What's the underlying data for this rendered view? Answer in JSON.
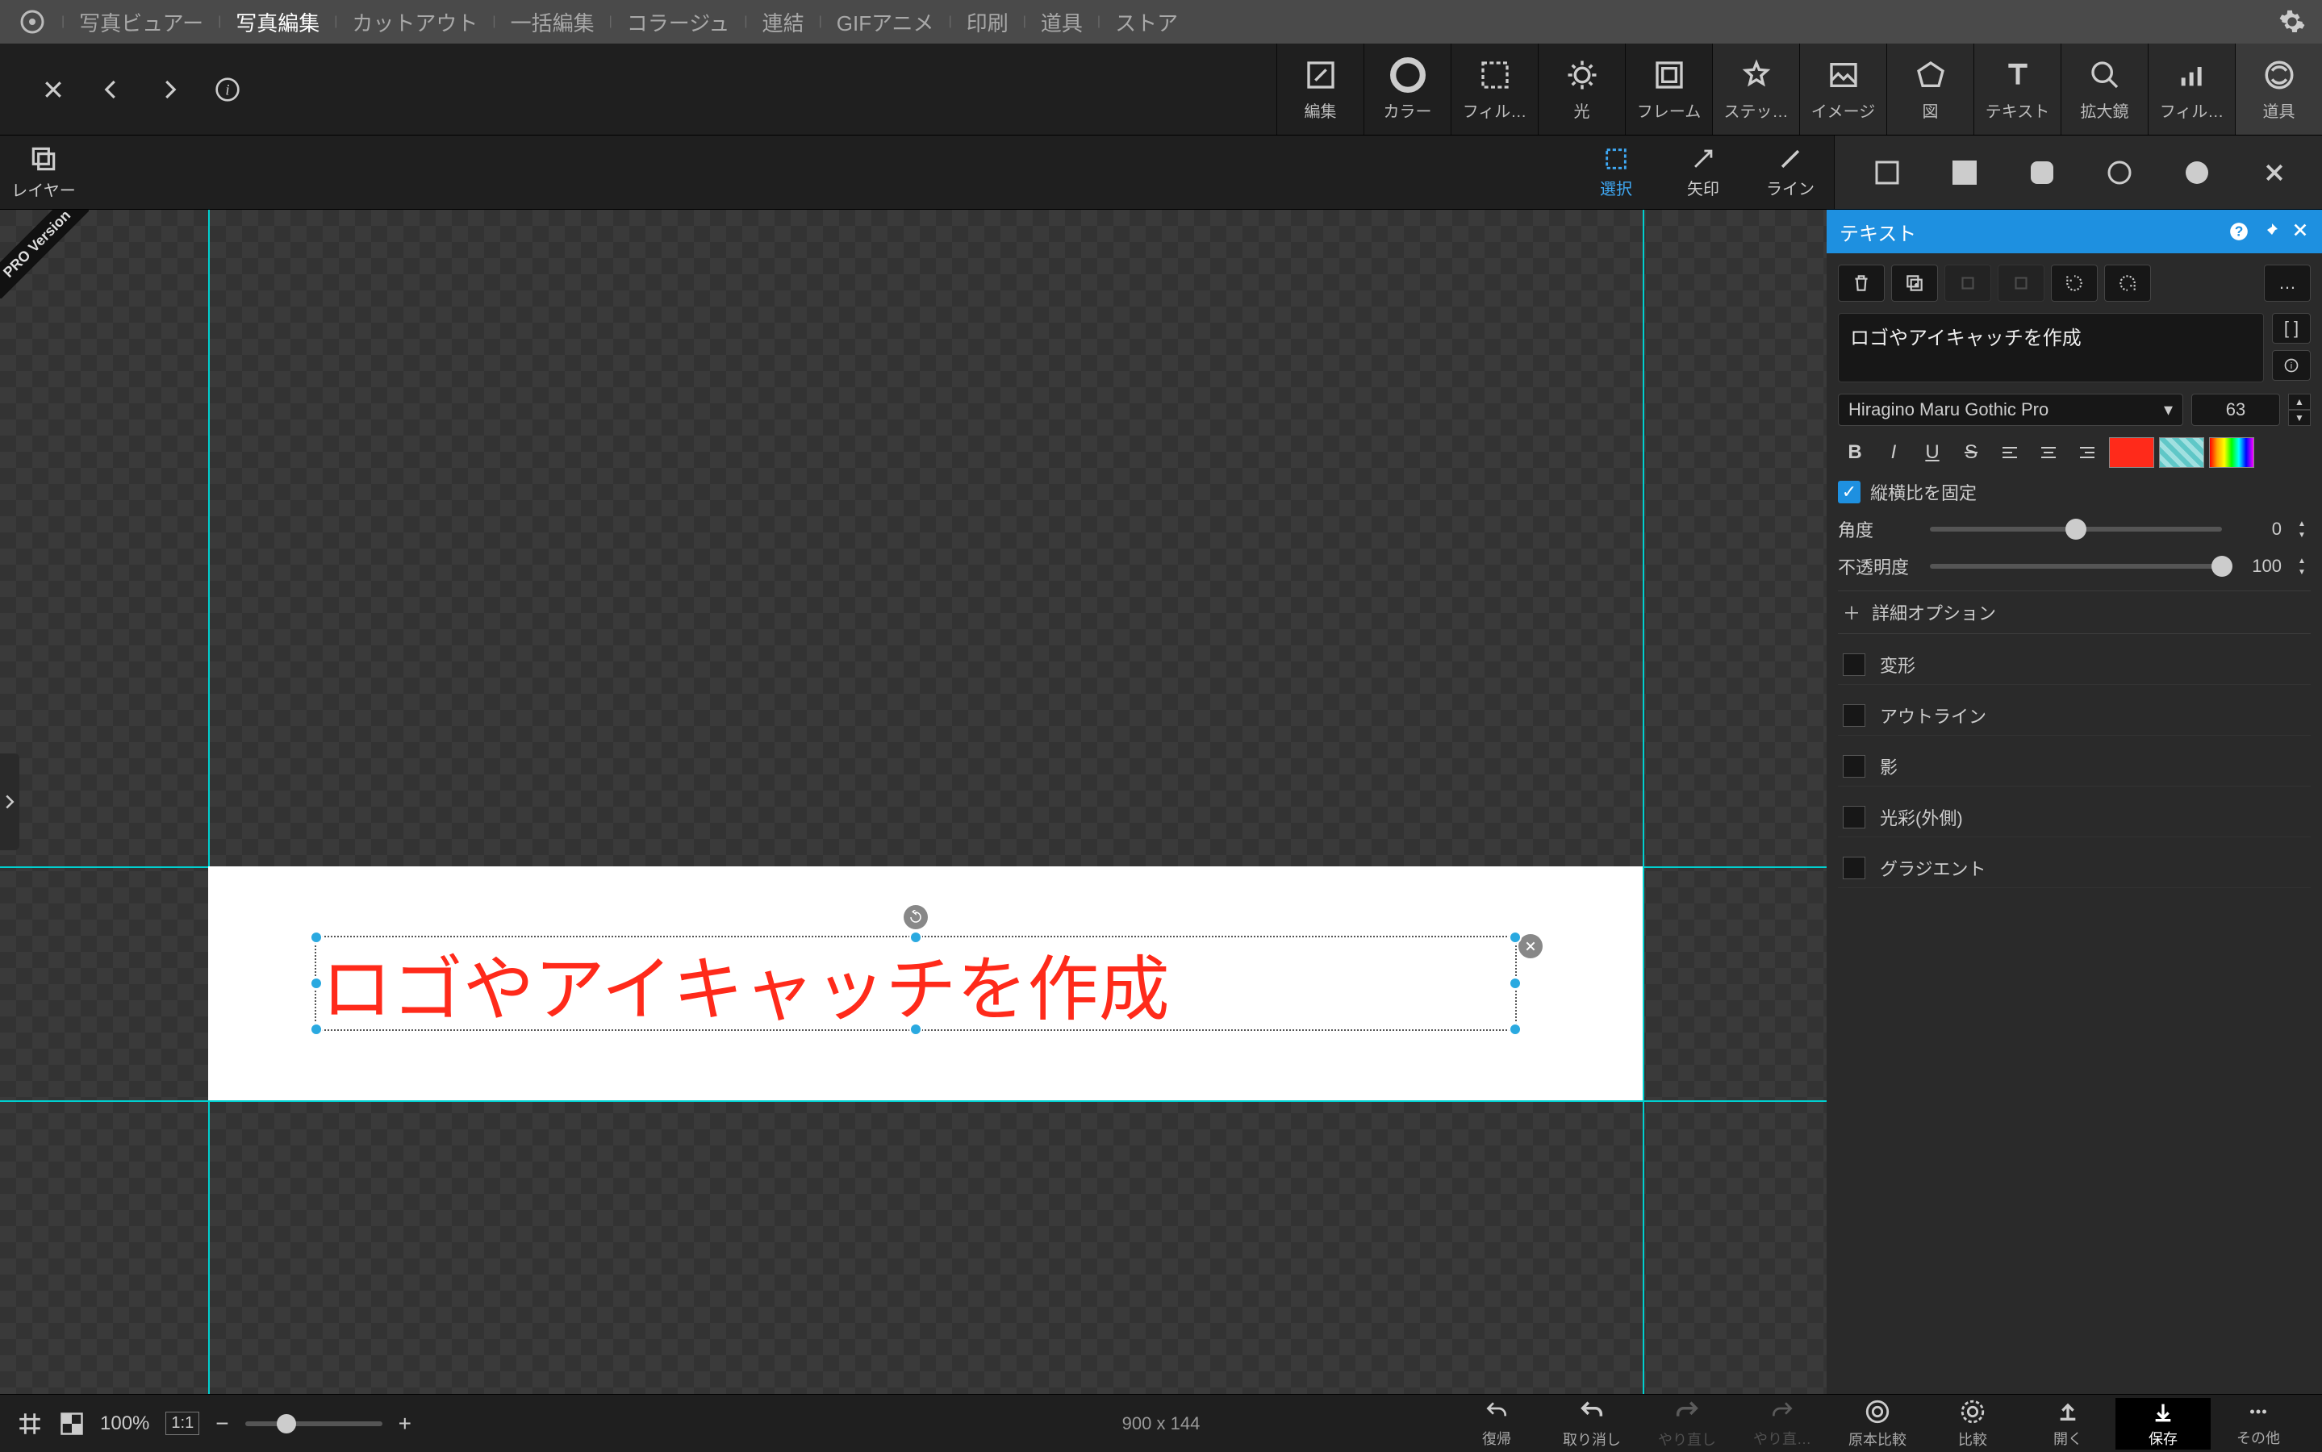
{
  "topmenu": {
    "items": [
      "写真ビュアー",
      "写真編集",
      "カットアウト",
      "一括編集",
      "コラージュ",
      "連結",
      "GIFアニメ",
      "印刷",
      "道具",
      "ストア"
    ],
    "active_index": 1
  },
  "ribbon": [
    {
      "label": "編集"
    },
    {
      "label": "カラー"
    },
    {
      "label": "フィル…"
    },
    {
      "label": "光"
    },
    {
      "label": "フレーム"
    },
    {
      "label": "ステッ…"
    },
    {
      "label": "イメージ"
    },
    {
      "label": "図"
    },
    {
      "label": "テキスト"
    },
    {
      "label": "拡大鏡"
    },
    {
      "label": "フィル…"
    },
    {
      "label": "道具"
    }
  ],
  "layers_label": "レイヤー",
  "subtools": [
    {
      "label": "選択",
      "active": true
    },
    {
      "label": "矢印"
    },
    {
      "label": "ライン"
    }
  ],
  "pro_badge": "PRO Version",
  "canvas": {
    "text": "ロゴやアイキャッチを作成",
    "dimensions": "900 x 144"
  },
  "text_panel": {
    "title": "テキスト",
    "content": "ロゴやアイキャッチを作成",
    "font": "Hiragino Maru Gothic Pro",
    "size": "63",
    "aspect_lock": "縦横比を固定",
    "angle_label": "角度",
    "angle_value": "0",
    "opacity_label": "不透明度",
    "opacity_value": "100",
    "advanced": "詳細オプション",
    "options": [
      "変形",
      "アウトライン",
      "影",
      "光彩(外側)",
      "グラジエント"
    ],
    "text_color": "#ff2a1a"
  },
  "bottom": {
    "zoom": "100%",
    "fit": "1:1",
    "actions": [
      {
        "label": "復帰"
      },
      {
        "label": "取り消し"
      },
      {
        "label": "やり直し",
        "disabled": true
      },
      {
        "label": "やり直…",
        "disabled": true
      },
      {
        "label": "原本比較"
      },
      {
        "label": "比較"
      },
      {
        "label": "開く"
      },
      {
        "label": "保存",
        "active": true
      },
      {
        "label": "その他"
      }
    ]
  }
}
